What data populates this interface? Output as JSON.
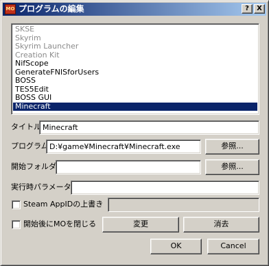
{
  "window": {
    "icon_text": "MO",
    "title": "プログラムの編集",
    "help_button": "?",
    "close_button": "X"
  },
  "programs": [
    {
      "label": "SKSE",
      "state": "disabled"
    },
    {
      "label": "Skyrim",
      "state": "disabled"
    },
    {
      "label": "Skyrim Launcher",
      "state": "disabled"
    },
    {
      "label": "Creation Kit",
      "state": "disabled"
    },
    {
      "label": "NifScope",
      "state": "normal"
    },
    {
      "label": "GenerateFNISforUsers",
      "state": "normal"
    },
    {
      "label": "BOSS",
      "state": "normal"
    },
    {
      "label": "TES5Edit",
      "state": "normal"
    },
    {
      "label": "BOSS GUI",
      "state": "normal"
    },
    {
      "label": "Minecraft",
      "state": "selected"
    }
  ],
  "form": {
    "title_label": "タイトル",
    "title_value": "Minecraft",
    "program_label": "プログラム",
    "program_value": "D:¥game¥Minecraft¥Minecraft.exe",
    "browse_program": "参照...",
    "start_folder_label": "開始フォルダ",
    "start_folder_value": "",
    "browse_folder": "参照...",
    "params_label": "実行時パラメータ",
    "params_value": "",
    "steam_appid_label": "Steam AppIDの上書き",
    "steam_appid_value": "",
    "close_mo_label": "開始後にMOを閉じる",
    "modify_button": "変更",
    "remove_button": "消去"
  },
  "footer": {
    "ok": "OK",
    "cancel": "Cancel"
  },
  "colors": {
    "selection": "#0a246a",
    "face": "#d4d0c8",
    "disabled_text": "#8a8a8a"
  }
}
